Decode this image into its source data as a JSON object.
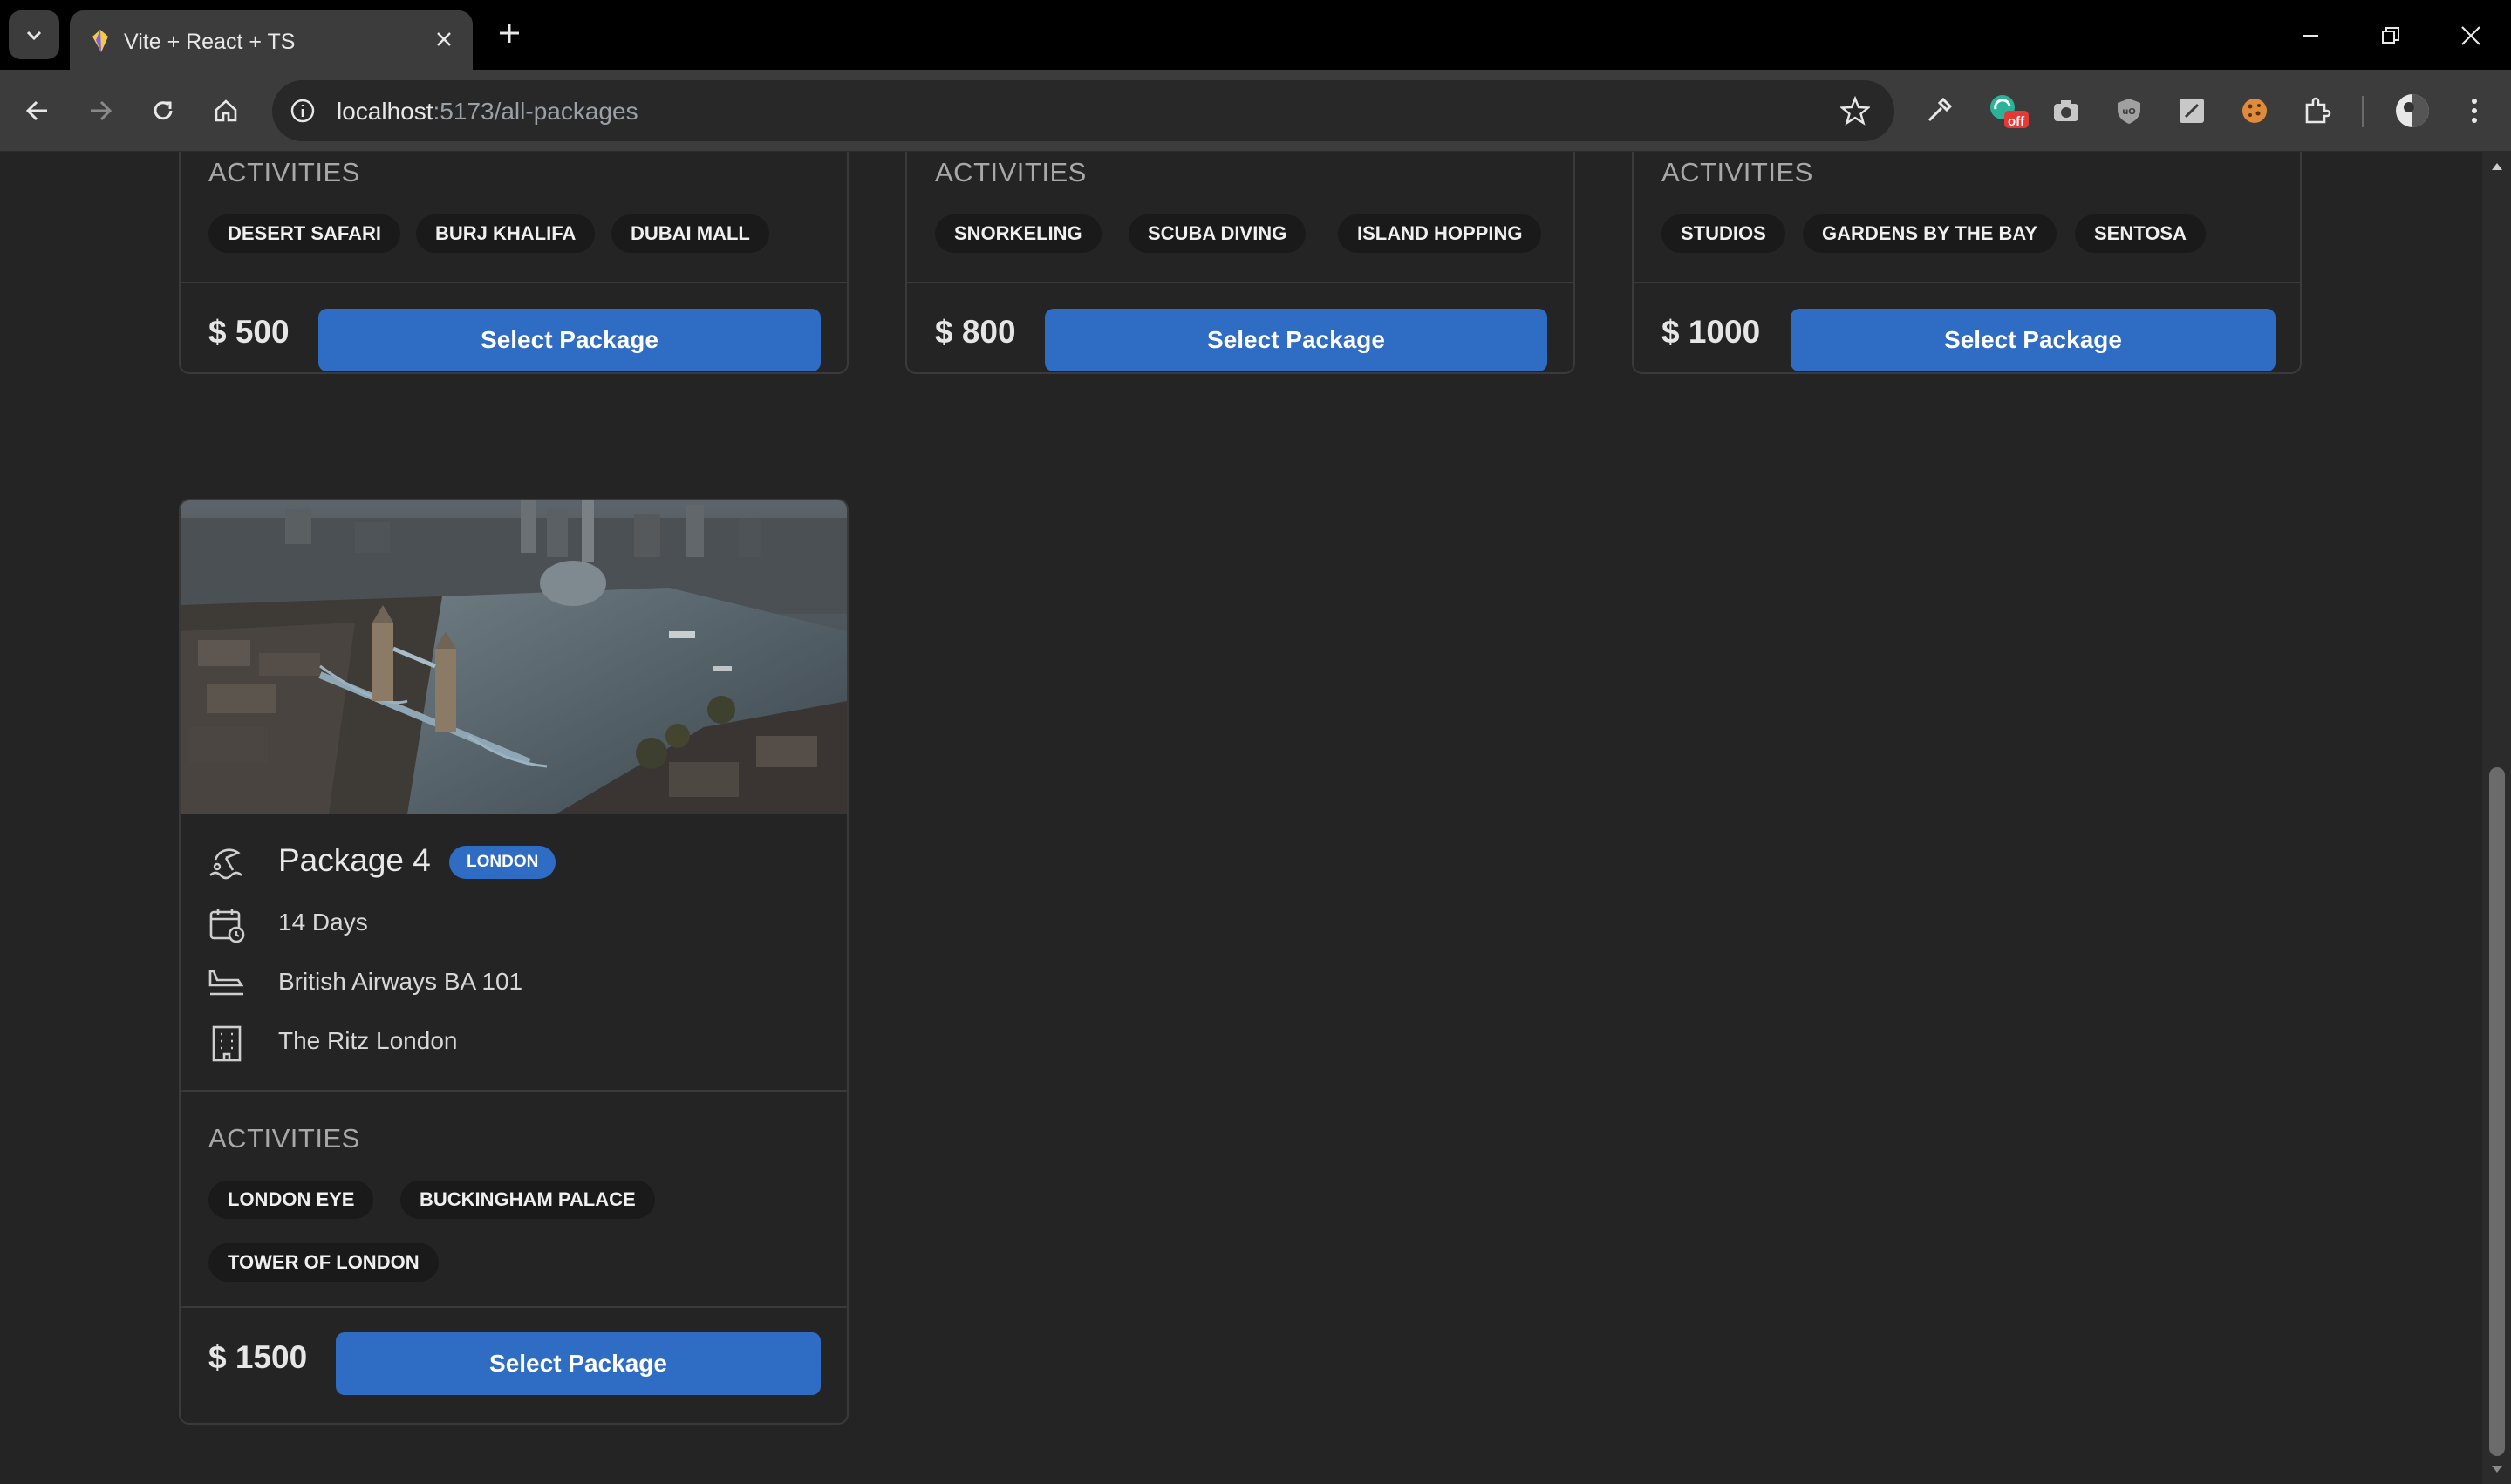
{
  "browser": {
    "tab_title": "Vite + React + TS",
    "url_host": "localhost",
    "url_rest": ":5173/all-packages",
    "extension_badge": "off"
  },
  "cards_top": [
    {
      "activities_label": "ACTIVITIES",
      "activities": [
        "DESERT SAFARI",
        "BURJ KHALIFA",
        "DUBAI MALL"
      ],
      "price": "$ 500",
      "button": "Select Package"
    },
    {
      "activities_label": "ACTIVITIES",
      "activities": [
        "SNORKELING",
        "SCUBA DIVING",
        "ISLAND HOPPING"
      ],
      "price": "$ 800",
      "button": "Select Package"
    },
    {
      "activities_label": "ACTIVITIES",
      "activities": [
        "STUDIOS",
        "GARDENS BY THE BAY",
        "SENTOSA"
      ],
      "price": "$ 1000",
      "button": "Select Package"
    }
  ],
  "package4": {
    "title": "Package 4",
    "badge": "LONDON",
    "duration": "14 Days",
    "flight": "British Airways BA 101",
    "hotel": "The Ritz London",
    "activities_label": "ACTIVITIES",
    "activities": [
      "LONDON EYE",
      "BUCKINGHAM PALACE",
      "TOWER OF LONDON"
    ],
    "price": "$ 1500",
    "button": "Select Package"
  },
  "colors": {
    "accent": "#2f6cc4",
    "background": "#242424",
    "chip": "#1a1a1a",
    "border": "#3a3a3a"
  }
}
